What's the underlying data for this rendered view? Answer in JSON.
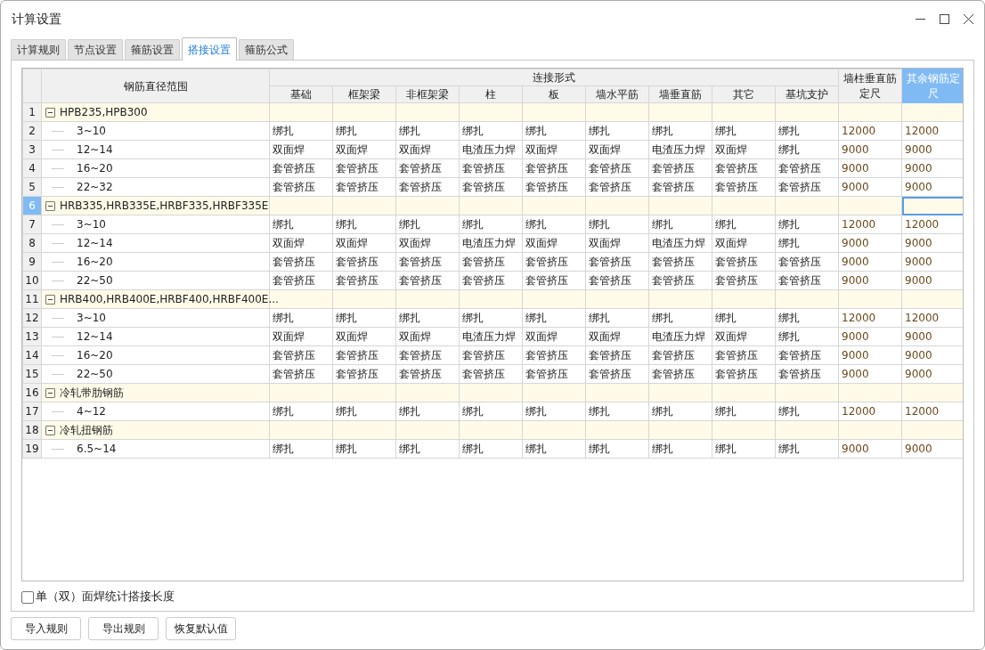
{
  "window": {
    "title": "计算设置"
  },
  "tabs": [
    {
      "label": "计算规则",
      "selected": false
    },
    {
      "label": "节点设置",
      "selected": false
    },
    {
      "label": "箍筋设置",
      "selected": false
    },
    {
      "label": "搭接设置",
      "selected": true
    },
    {
      "label": "箍筋公式",
      "selected": false
    }
  ],
  "table": {
    "range_header": "钢筋直径范围",
    "group_header": "连接形式",
    "connection_columns": [
      "基础",
      "框架梁",
      "非框架梁",
      "柱",
      "板",
      "墙水平筋",
      "墙垂直筋",
      "其它",
      "基坑支护"
    ],
    "extra_columns": [
      {
        "label": "墙柱垂直筋定尺",
        "selected": false
      },
      {
        "label": "其余钢筋定尺",
        "selected": true
      }
    ],
    "rows": [
      {
        "number": "1",
        "kind": "group",
        "label": "HPB235,HPB300",
        "expanded": true,
        "selected": false
      },
      {
        "number": "2",
        "kind": "item",
        "label": "3~10",
        "cells": [
          "绑扎",
          "绑扎",
          "绑扎",
          "绑扎",
          "绑扎",
          "绑扎",
          "绑扎",
          "绑扎",
          "绑扎",
          "12000",
          "12000"
        ]
      },
      {
        "number": "3",
        "kind": "item",
        "label": "12~14",
        "cells": [
          "双面焊",
          "双面焊",
          "双面焊",
          "电渣压力焊",
          "双面焊",
          "双面焊",
          "电渣压力焊",
          "双面焊",
          "绑扎",
          "9000",
          "9000"
        ]
      },
      {
        "number": "4",
        "kind": "item",
        "label": "16~20",
        "cells": [
          "套管挤压",
          "套管挤压",
          "套管挤压",
          "套管挤压",
          "套管挤压",
          "套管挤压",
          "套管挤压",
          "套管挤压",
          "套管挤压",
          "9000",
          "9000"
        ]
      },
      {
        "number": "5",
        "kind": "item",
        "label": "22~32",
        "cells": [
          "套管挤压",
          "套管挤压",
          "套管挤压",
          "套管挤压",
          "套管挤压",
          "套管挤压",
          "套管挤压",
          "套管挤压",
          "套管挤压",
          "9000",
          "9000"
        ]
      },
      {
        "number": "6",
        "kind": "group",
        "label": "HRB335,HRB335E,HRBF335,HRBF335E",
        "expanded": true,
        "selected": true
      },
      {
        "number": "7",
        "kind": "item",
        "label": "3~10",
        "cells": [
          "绑扎",
          "绑扎",
          "绑扎",
          "绑扎",
          "绑扎",
          "绑扎",
          "绑扎",
          "绑扎",
          "绑扎",
          "12000",
          "12000"
        ]
      },
      {
        "number": "8",
        "kind": "item",
        "label": "12~14",
        "cells": [
          "双面焊",
          "双面焊",
          "双面焊",
          "电渣压力焊",
          "双面焊",
          "双面焊",
          "电渣压力焊",
          "双面焊",
          "绑扎",
          "9000",
          "9000"
        ]
      },
      {
        "number": "9",
        "kind": "item",
        "label": "16~20",
        "cells": [
          "套管挤压",
          "套管挤压",
          "套管挤压",
          "套管挤压",
          "套管挤压",
          "套管挤压",
          "套管挤压",
          "套管挤压",
          "套管挤压",
          "9000",
          "9000"
        ]
      },
      {
        "number": "10",
        "kind": "item",
        "label": "22~50",
        "cells": [
          "套管挤压",
          "套管挤压",
          "套管挤压",
          "套管挤压",
          "套管挤压",
          "套管挤压",
          "套管挤压",
          "套管挤压",
          "套管挤压",
          "9000",
          "9000"
        ]
      },
      {
        "number": "11",
        "kind": "group",
        "label": "HRB400,HRB400E,HRBF400,HRBF400E...",
        "expanded": true,
        "selected": false
      },
      {
        "number": "12",
        "kind": "item",
        "label": "3~10",
        "cells": [
          "绑扎",
          "绑扎",
          "绑扎",
          "绑扎",
          "绑扎",
          "绑扎",
          "绑扎",
          "绑扎",
          "绑扎",
          "12000",
          "12000"
        ]
      },
      {
        "number": "13",
        "kind": "item",
        "label": "12~14",
        "cells": [
          "双面焊",
          "双面焊",
          "双面焊",
          "电渣压力焊",
          "双面焊",
          "双面焊",
          "电渣压力焊",
          "双面焊",
          "绑扎",
          "9000",
          "9000"
        ]
      },
      {
        "number": "14",
        "kind": "item",
        "label": "16~20",
        "cells": [
          "套管挤压",
          "套管挤压",
          "套管挤压",
          "套管挤压",
          "套管挤压",
          "套管挤压",
          "套管挤压",
          "套管挤压",
          "套管挤压",
          "9000",
          "9000"
        ]
      },
      {
        "number": "15",
        "kind": "item",
        "label": "22~50",
        "cells": [
          "套管挤压",
          "套管挤压",
          "套管挤压",
          "套管挤压",
          "套管挤压",
          "套管挤压",
          "套管挤压",
          "套管挤压",
          "套管挤压",
          "9000",
          "9000"
        ]
      },
      {
        "number": "16",
        "kind": "group",
        "label": "冷轧带肋钢筋",
        "expanded": true,
        "selected": false
      },
      {
        "number": "17",
        "kind": "item",
        "label": "4~12",
        "cells": [
          "绑扎",
          "绑扎",
          "绑扎",
          "绑扎",
          "绑扎",
          "绑扎",
          "绑扎",
          "绑扎",
          "绑扎",
          "12000",
          "12000"
        ]
      },
      {
        "number": "18",
        "kind": "group",
        "label": "冷轧扭钢筋",
        "expanded": true,
        "selected": false
      },
      {
        "number": "19",
        "kind": "item",
        "label": "6.5~14",
        "cells": [
          "绑扎",
          "绑扎",
          "绑扎",
          "绑扎",
          "绑扎",
          "绑扎",
          "绑扎",
          "绑扎",
          "绑扎",
          "9000",
          "9000"
        ]
      }
    ]
  },
  "option": {
    "label": "单（双）面焊统计搭接长度",
    "checked": false
  },
  "buttons": [
    "导入规则",
    "导出规则",
    "恢复默认值"
  ]
}
